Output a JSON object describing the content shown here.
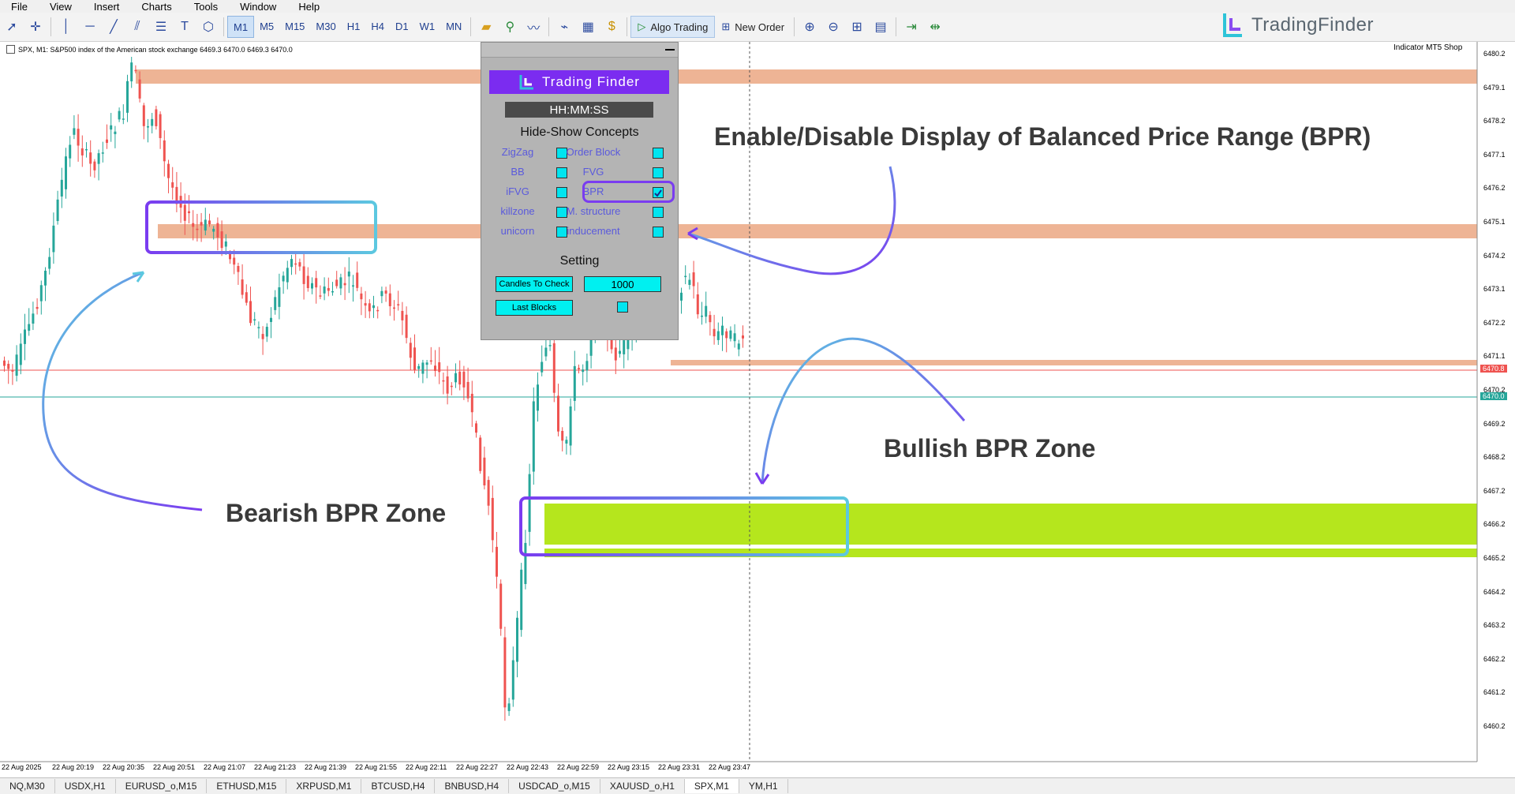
{
  "menu": [
    "File",
    "View",
    "Insert",
    "Charts",
    "Tools",
    "Window",
    "Help"
  ],
  "toolbar": {
    "timeframes": [
      "M1",
      "M5",
      "M15",
      "M30",
      "H1",
      "H4",
      "D1",
      "W1",
      "MN"
    ],
    "active_timeframe": "M1",
    "algo_trading": "Algo Trading",
    "new_order": "New Order"
  },
  "brand": {
    "name": "TradingFinder"
  },
  "chart": {
    "info": "SPX, M1:  S&P500 index of the American stock exchange  6469.3 6470.0 6469.3 6470.0",
    "indicator_label": "Indicator MT5 Shop",
    "price_labels": [
      "6480.2",
      "6479.1",
      "6478.2",
      "6477.1",
      "6476.2",
      "6475.1",
      "6474.2",
      "6473.1",
      "6472.2",
      "6471.1",
      "6470.2",
      "6469.2",
      "6468.2",
      "6467.2",
      "6466.2",
      "6465.2",
      "6464.2",
      "6463.2",
      "6462.2",
      "6461.2",
      "6460.2"
    ],
    "current_price_red": "6470.8",
    "current_price": "6470.0",
    "time_labels": [
      "22 Aug 2025",
      "22 Aug 20:19",
      "22 Aug 20:35",
      "22 Aug 20:51",
      "22 Aug 21:07",
      "22 Aug 21:23",
      "22 Aug 21:39",
      "22 Aug 21:55",
      "22 Aug 22:11",
      "22 Aug 22:27",
      "22 Aug 22:43",
      "22 Aug 22:59",
      "22 Aug 23:15",
      "22 Aug 23:31",
      "22 Aug 23:47"
    ],
    "colors": {
      "bear_zone": "#eeb495",
      "bull_zone": "#b5e61d",
      "bull_candle": "#26a69a",
      "bear_candle": "#ef5350"
    }
  },
  "panel": {
    "brand": "Trading Finder",
    "clock": "HH:MM:SS",
    "hide_show_title": "Hide-Show Concepts",
    "concepts": [
      {
        "label": "ZigZag",
        "checked": false
      },
      {
        "label": "Order Block",
        "checked": false
      },
      {
        "label": "BB",
        "checked": false
      },
      {
        "label": "FVG",
        "checked": false
      },
      {
        "label": "iFVG",
        "checked": false
      },
      {
        "label": "BPR",
        "checked": true
      },
      {
        "label": "killzone",
        "checked": false
      },
      {
        "label": "M. structure",
        "checked": false
      },
      {
        "label": "unicorn",
        "checked": false
      },
      {
        "label": "inducement",
        "checked": false
      }
    ],
    "setting_title": "Setting",
    "candles_to_check_label": "Candles To Check",
    "candles_to_check_value": "1000",
    "last_blocks_label": "Last Blocks"
  },
  "annotations": {
    "enable_disable": "Enable/Disable Display of Balanced Price Range (BPR)",
    "bullish": "Bullish BPR Zone",
    "bearish": "Bearish BPR Zone"
  },
  "symbol_tabs": [
    "NQ,M30",
    "USDX,H1",
    "EURUSD_o,M15",
    "ETHUSD,M15",
    "XRPUSD,M1",
    "BTCUSD,H4",
    "BNBUSD,H4",
    "USDCAD_o,M15",
    "XAUUSD_o,H1",
    "SPX,M1",
    "YM,H1"
  ],
  "active_symbol_tab": "SPX,M1"
}
